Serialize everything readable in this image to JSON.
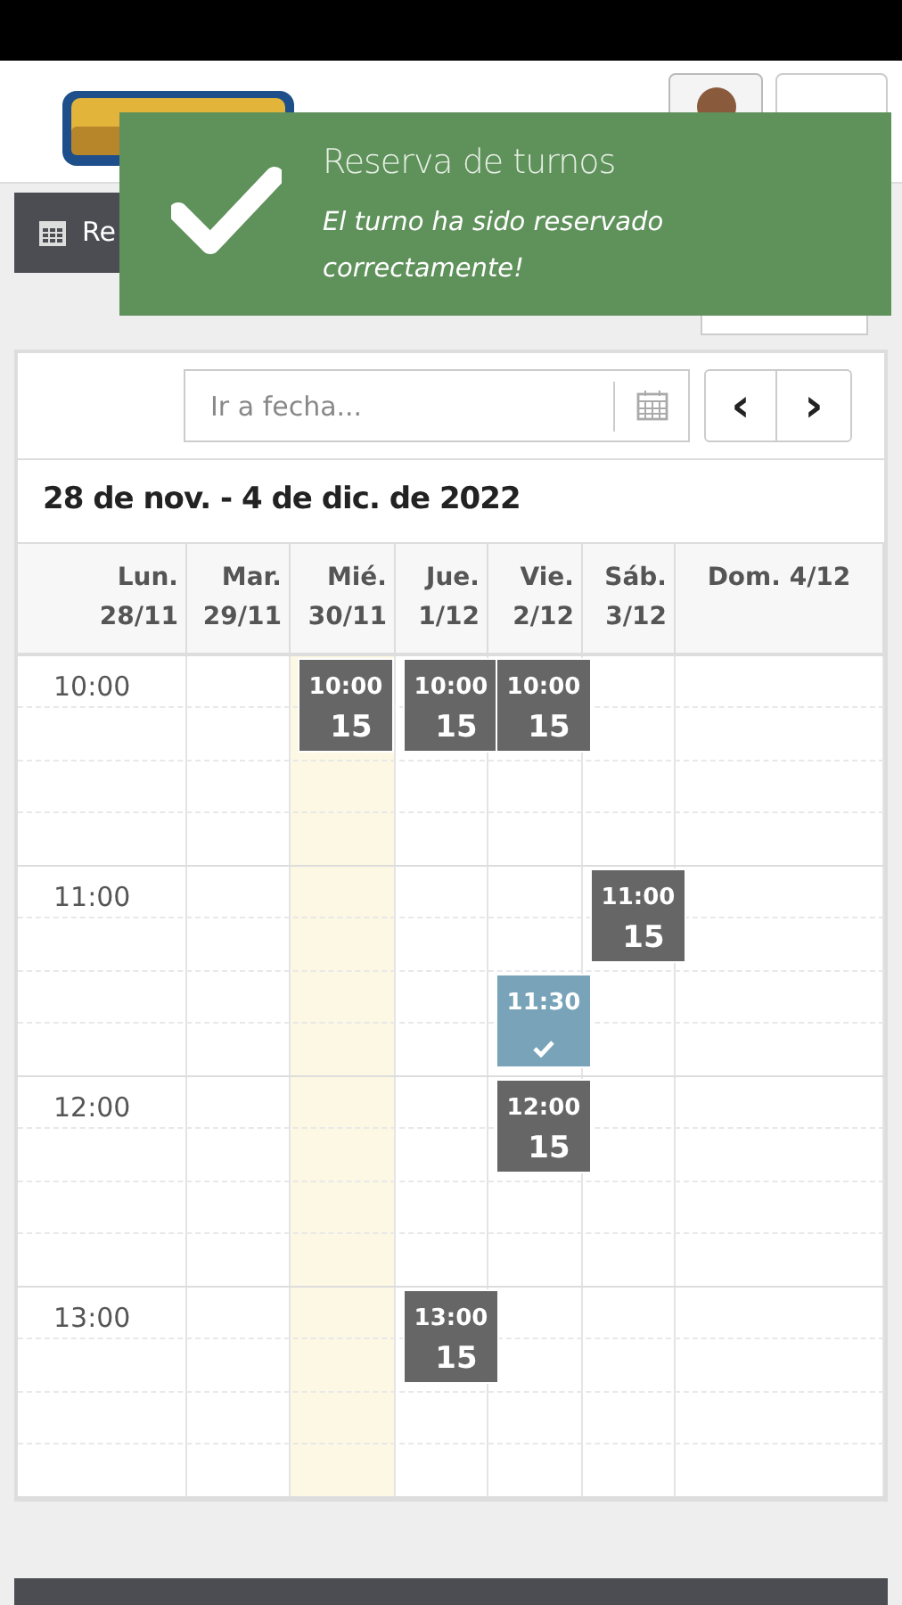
{
  "toolbar": {
    "calendar_button": "Re"
  },
  "toast": {
    "title": "Reserva de turnos",
    "message": "El turno ha sido reservado correctamente!"
  },
  "calendar": {
    "date_placeholder": "Ir a fecha...",
    "prev": "‹",
    "next": "›",
    "range_title": "28 de nov. - 4 de dic. de 2022",
    "columns": [
      {
        "day": "Lun.",
        "date": "28/11",
        "today": false
      },
      {
        "day": "Mar.",
        "date": "29/11",
        "today": false
      },
      {
        "day": "Mié.",
        "date": "30/11",
        "today": true,
        "events": [
          {
            "kind": "available",
            "time": "10:00",
            "count": "15"
          }
        ]
      },
      {
        "day": "Jue.",
        "date": "1/12",
        "today": false,
        "events": [
          {
            "kind": "available",
            "time": "10:00",
            "count": "15"
          },
          {
            "kind": "available",
            "time": "13:00",
            "count": "15"
          }
        ]
      },
      {
        "day": "Vie.",
        "date": "2/12",
        "today": false,
        "events": [
          {
            "kind": "available",
            "time": "10:00",
            "count": "15"
          },
          {
            "kind": "booked",
            "time": "11:30"
          },
          {
            "kind": "available",
            "time": "12:00",
            "count": "15"
          }
        ]
      },
      {
        "day": "Sáb.",
        "date": "3/12",
        "today": false,
        "events": [
          {
            "kind": "available",
            "time": "11:00",
            "count": "15"
          }
        ]
      },
      {
        "day": "Dom.",
        "date": "4/12",
        "today": false
      }
    ],
    "hours": [
      "10:00",
      "11:00",
      "12:00",
      "13:00"
    ]
  }
}
